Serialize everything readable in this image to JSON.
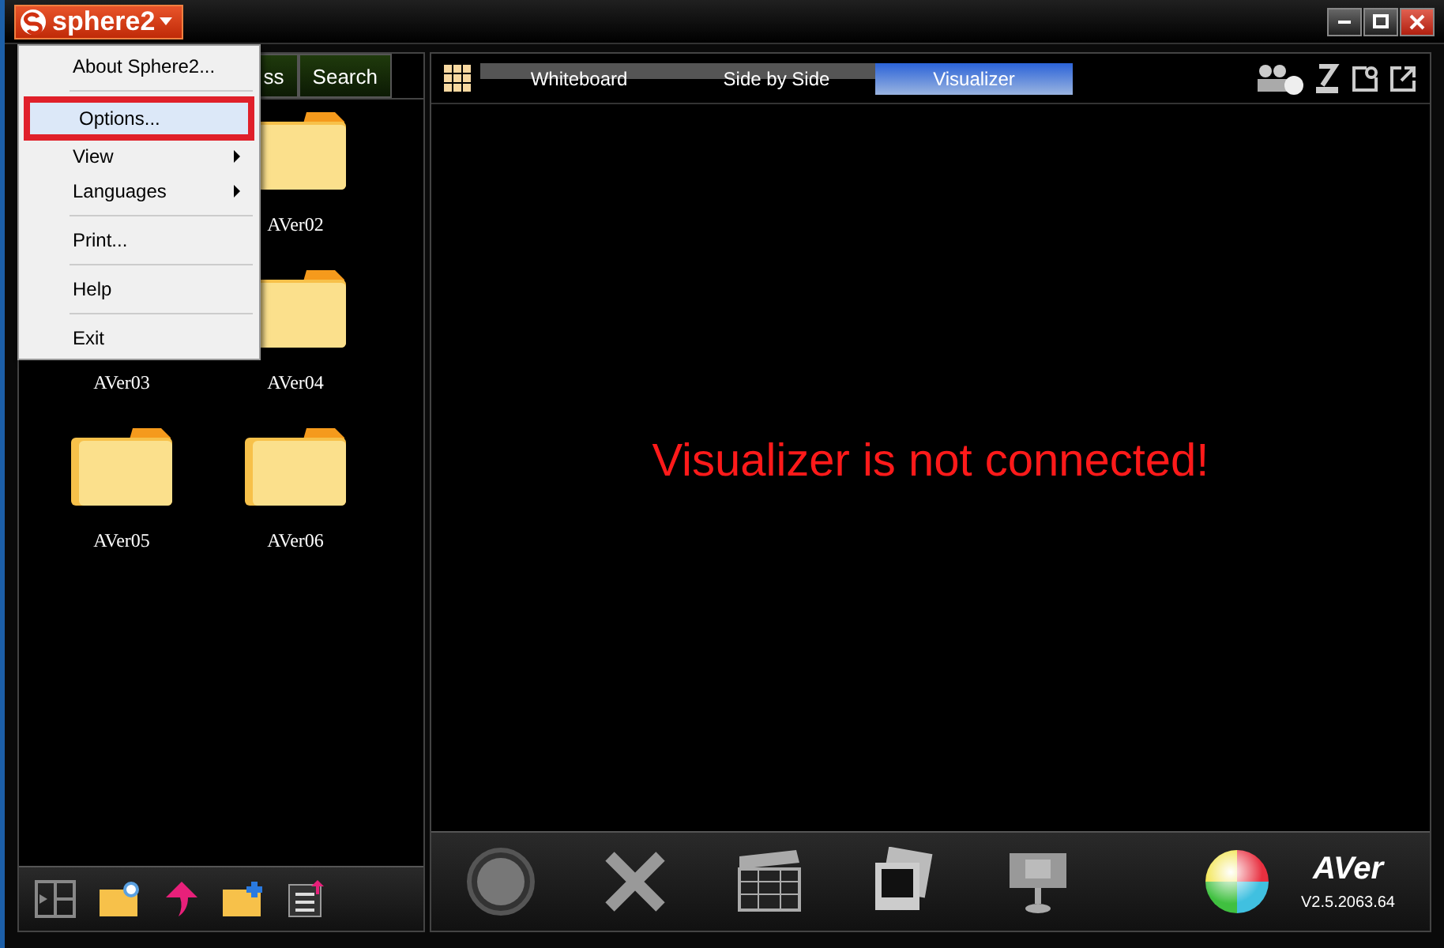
{
  "app_button": {
    "label": "sphere2"
  },
  "menu": {
    "items": [
      {
        "label": "About Sphere2...",
        "selected": false,
        "submenu": false
      },
      {
        "label": "Options...",
        "selected": true,
        "submenu": false
      },
      {
        "label": "View",
        "selected": false,
        "submenu": true
      },
      {
        "label": "Languages",
        "selected": false,
        "submenu": true
      },
      {
        "label": "Print...",
        "selected": false,
        "submenu": false
      },
      {
        "label": "Help",
        "selected": false,
        "submenu": false
      },
      {
        "label": "Exit",
        "selected": false,
        "submenu": false
      }
    ]
  },
  "left_tabs": [
    {
      "label": "ss"
    },
    {
      "label": "Search"
    }
  ],
  "folders": [
    {
      "label": "AVer02"
    },
    {
      "label": "AVer03"
    },
    {
      "label": "AVer04"
    },
    {
      "label": "AVer05"
    },
    {
      "label": "AVer06"
    }
  ],
  "view_tabs": [
    {
      "label": "Whiteboard",
      "selected": false
    },
    {
      "label": "Side by Side",
      "selected": false
    },
    {
      "label": "Visualizer",
      "selected": true
    }
  ],
  "message": "Visualizer is not connected!",
  "brand": {
    "logo": "AVer",
    "version": "V2.5.2063.64"
  }
}
